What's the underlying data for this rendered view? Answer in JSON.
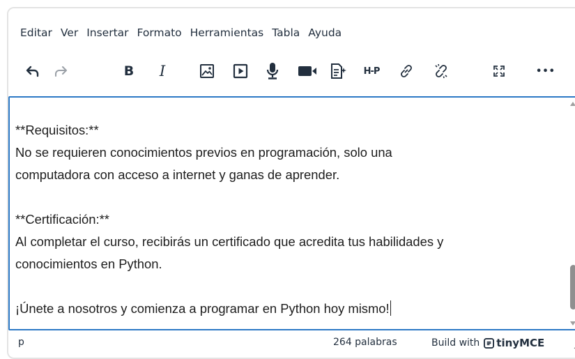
{
  "menubar": {
    "items": [
      "Editar",
      "Ver",
      "Insertar",
      "Formato",
      "Herramientas",
      "Tabla",
      "Ayuda"
    ]
  },
  "toolbar": {
    "bold_label": "B",
    "italic_label": "I",
    "h5p_label": "H-P",
    "more_label": "•••",
    "buttons": [
      "undo-icon",
      "redo-icon",
      "bold",
      "italic",
      "image-icon",
      "media-icon",
      "microphone-icon",
      "video-camera-icon",
      "ai-document-icon",
      "h5p",
      "link-icon",
      "unlink-icon",
      "fullscreen-icon",
      "more-icon"
    ]
  },
  "content": {
    "paragraphs": [
      "**Requisitos:**",
      "No se requieren conocimientos previos en programación, solo una",
      "computadora con acceso a internet y ganas de aprender.",
      "",
      "**Certificación:**",
      "Al completar el curso, recibirás un certificado que acredita tus habilidades y",
      "conocimientos en Python.",
      "",
      "¡Únete a nosotros y comienza a programar en Python hoy mismo!"
    ]
  },
  "statusbar": {
    "path": "p",
    "word_count": "264 palabras",
    "brand_prefix": "Build with",
    "brand_name": "tinyMCE"
  },
  "colors": {
    "focus_border": "#2b78c5",
    "text": "#222f3e"
  }
}
